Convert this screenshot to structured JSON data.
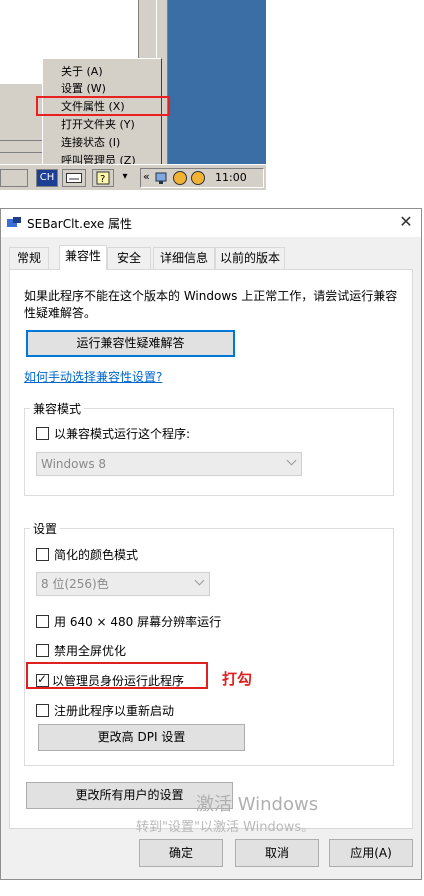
{
  "context_menu": {
    "items": [
      {
        "label": "关于 (A)"
      },
      {
        "label": "设置 (W)"
      },
      {
        "label": "文件属性 (X)"
      },
      {
        "label": "打开文件夹 (Y)"
      },
      {
        "label": "连接状态 (I)"
      },
      {
        "label": "呼叫管理员 (Z)"
      }
    ]
  },
  "taskbar": {
    "input_method": "CH",
    "clock": "11:00"
  },
  "dialog": {
    "title": "SEBarClt.exe 属性",
    "close_icon": "close-icon",
    "tabs": [
      {
        "label": "常规"
      },
      {
        "label": "兼容性"
      },
      {
        "label": "安全"
      },
      {
        "label": "详细信息"
      },
      {
        "label": "以前的版本"
      }
    ],
    "active_tab": "兼容性",
    "intro_text": "如果此程序不能在这个版本的 Windows 上正常工作，请尝试运行兼容性疑难解答。",
    "troubleshoot_button": "运行兼容性疑难解答",
    "manual_link": "如何手动选择兼容性设置?",
    "compat_mode": {
      "group_label": "兼容模式",
      "checkbox_label": "以兼容模式运行这个程序:",
      "checked": false,
      "select_value": "Windows 8"
    },
    "settings": {
      "group_label": "设置",
      "reduced_color_label": "简化的颜色模式",
      "reduced_color_checked": false,
      "color_select_value": "8 位(256)色",
      "resolution_label": "用 640 × 480 屏幕分辨率运行",
      "resolution_checked": false,
      "fullscreen_opt_label": "禁用全屏优化",
      "fullscreen_opt_checked": false,
      "run_as_admin_label": "以管理员身份运行此程序",
      "run_as_admin_checked": true,
      "register_restart_label": "注册此程序以重新启动",
      "register_restart_checked": false,
      "dpi_button": "更改高 DPI 设置"
    },
    "all_users_button": "更改所有用户的设置",
    "ok_button": "确定",
    "cancel_button": "取消",
    "apply_button": "应用(A)"
  },
  "annotation": {
    "label": "打勾",
    "color": "#e02020"
  },
  "watermark": {
    "line1": "激活 Windows",
    "line2": "转到\"设置\"以激活 Windows。"
  }
}
